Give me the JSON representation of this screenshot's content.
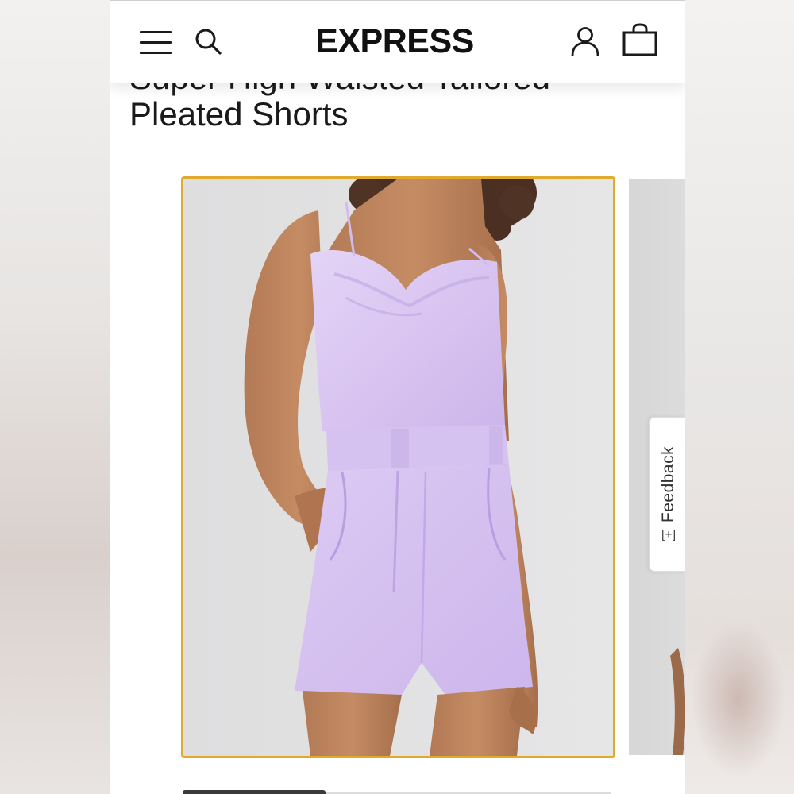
{
  "header": {
    "logo_text": "EXPRESS",
    "menu_icon": "hamburger-menu-icon",
    "search_icon": "search-icon",
    "account_icon": "user-account-icon",
    "bag_icon": "shopping-bag-icon"
  },
  "product": {
    "title_line1": "Super High Waisted Tailored",
    "title_line2": "Pleated Shorts",
    "main_image_alt": "Model wearing lavender cowl neck satin cami and lavender high waisted pleated shorts",
    "selected_border_color": "#e2a92f",
    "garment_color": "#dcc8f2"
  },
  "feedback": {
    "label": "Feedback",
    "icon": "[+]"
  }
}
